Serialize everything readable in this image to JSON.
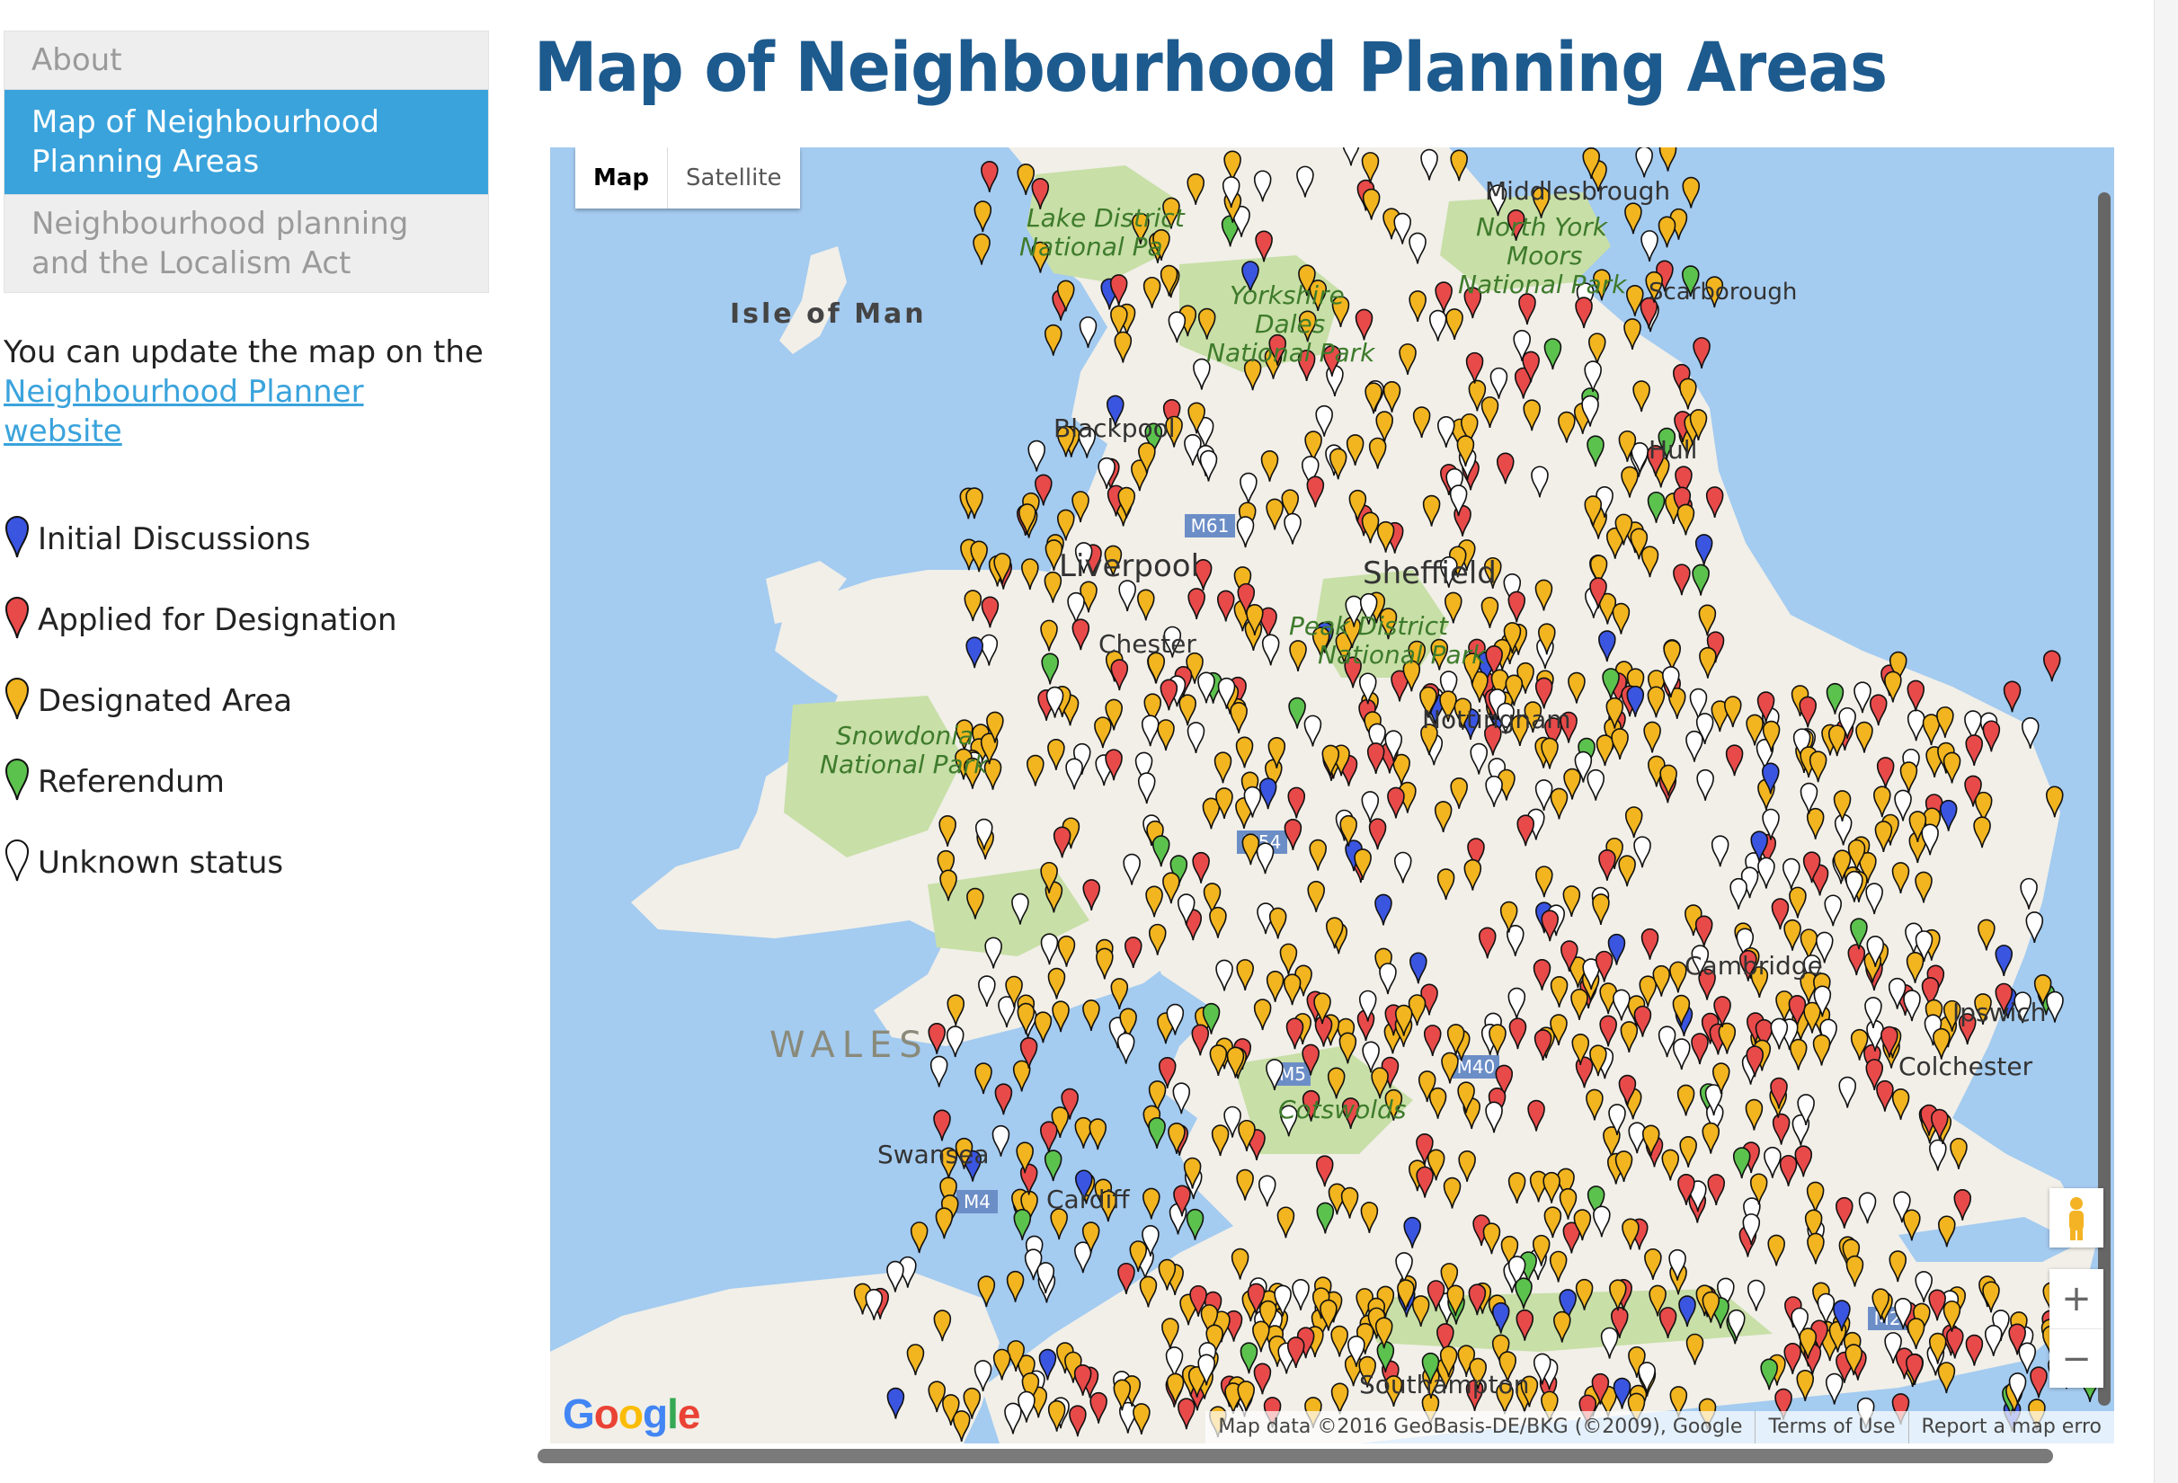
{
  "nav": {
    "items": [
      {
        "label": "About",
        "active": false
      },
      {
        "label": "Map of Neighbourhood Planning Areas",
        "active": true
      },
      {
        "label": "Neighbourhood planning and the Localism Act",
        "active": false
      }
    ]
  },
  "intro": {
    "text": "You can update the map on the",
    "link": "Neighbourhood Planner website"
  },
  "legend": [
    {
      "label": "Initial Discussions",
      "color": "#3a55e0"
    },
    {
      "label": "Applied for Designation",
      "color": "#e84a4a"
    },
    {
      "label": "Designated Area",
      "color": "#f2b51f"
    },
    {
      "label": "Referendum",
      "color": "#5cc24e"
    },
    {
      "label": "Unknown status",
      "color": "#ffffff"
    }
  ],
  "page_title": "Map of Neighbourhood Planning Areas",
  "map": {
    "type_control": {
      "map": "Map",
      "satellite": "Satellite"
    },
    "labels": {
      "middlesbrough": "Middlesbrough",
      "north_york": "North York",
      "moors": "Moors",
      "national_park_ny": "National Park",
      "scarborough": "Scarborough",
      "lake_district": "Lake District",
      "national_park_ld": "National Pa",
      "isle_of_man": "Isle of Man",
      "yorkshire": "Yorkshire",
      "dales": "Dales",
      "national_park_yd": "National Park",
      "blackpool": "Blackpool",
      "hull": "Hull",
      "liverpool": "Liverpool",
      "sheffield": "Sheffield",
      "peak_district": "Peak District",
      "national_park_pd": "National Park",
      "chester": "Chester",
      "nottingham": "Nottingham",
      "snowdonia": "Snowdonia",
      "national_park_sn": "National Park",
      "cambridge": "Cambridge",
      "ipswich": "Ipswich",
      "colchester": "Colchester",
      "wales": "WALES",
      "cotswolds": "Cotswolds",
      "swansea": "Swansea",
      "cardiff": "Cardiff",
      "southampton": "Southampton",
      "m61": "M61",
      "m54": "M54",
      "m4": "M4",
      "m5": "M5",
      "m40": "M40",
      "m20": "M20"
    },
    "attribution": {
      "data": "Map data ©2016 GeoBasis-DE/BKG (©2009), Google",
      "terms": "Terms of Use",
      "report": "Report a map erro"
    },
    "zoom_in": "+",
    "zoom_out": "−"
  }
}
